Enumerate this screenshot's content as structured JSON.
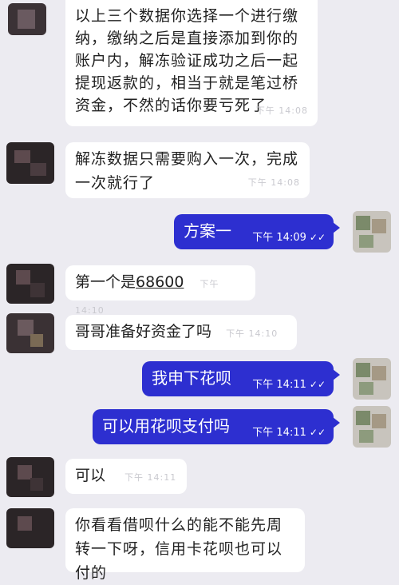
{
  "messages": [
    {
      "text": "以上三个数据你选择一个进行缴纳，缴纳之后是直接添加到你的账户内，解冻验证成功之后一起提现返款的，相当于就是笔过桥资金，不然的话你要亏死了",
      "time": "下午 14:08"
    },
    {
      "text": "解冻数据只需要购入一次，完成一次就行了",
      "time": "下午 14:08"
    },
    {
      "text": "方案一",
      "time": "下午 14:09",
      "status": "✓✓"
    },
    {
      "text_prefix": "第一个是",
      "link": "68600",
      "time": "下午 14:10"
    },
    {
      "text": "哥哥准备好资金了吗",
      "time": "下午 14:10"
    },
    {
      "text": "我申下花呗",
      "time": "下午 14:11",
      "status": "✓✓"
    },
    {
      "text": "可以用花呗支付吗",
      "time": "下午 14:11",
      "status": "✓✓"
    },
    {
      "text": "可以",
      "time": "下午 14:11"
    },
    {
      "text": "你看看借呗什么的能不能先周转一下呀，信用卡花呗也可以付的"
    }
  ],
  "colors": {
    "background": "#ecebf1",
    "incoming_bubble": "#ffffff",
    "outgoing_bubble": "#2d2fd0"
  }
}
